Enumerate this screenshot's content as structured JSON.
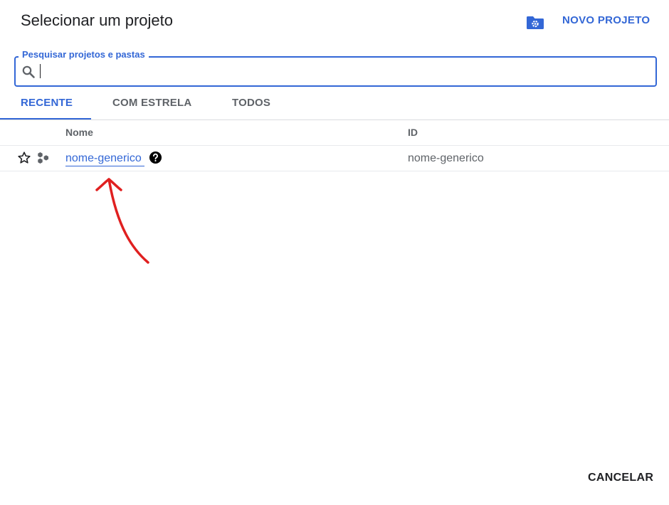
{
  "dialog": {
    "title": "Selecionar um projeto",
    "new_project_label": "NOVO PROJETO",
    "cancel_label": "CANCELAR"
  },
  "search": {
    "label": "Pesquisar projetos e pastas",
    "value": ""
  },
  "tabs": [
    {
      "label": "RECENTE",
      "active": true
    },
    {
      "label": "COM ESTRELA",
      "active": false
    },
    {
      "label": "TODOS",
      "active": false
    }
  ],
  "table": {
    "columns": [
      "Nome",
      "ID"
    ],
    "rows": [
      {
        "name": "nome-generico",
        "id": "nome-generico",
        "starred": false
      }
    ]
  },
  "icons": {
    "new_project": "folder-settings-icon",
    "search": "search-icon",
    "star": "star-outline-icon",
    "project_type": "project-hexagons-icon",
    "help": "help-circle-icon"
  },
  "colors": {
    "accent": "#3367d6",
    "annotation": "#e02020",
    "text_primary": "#202124",
    "text_secondary": "#5f6368"
  }
}
